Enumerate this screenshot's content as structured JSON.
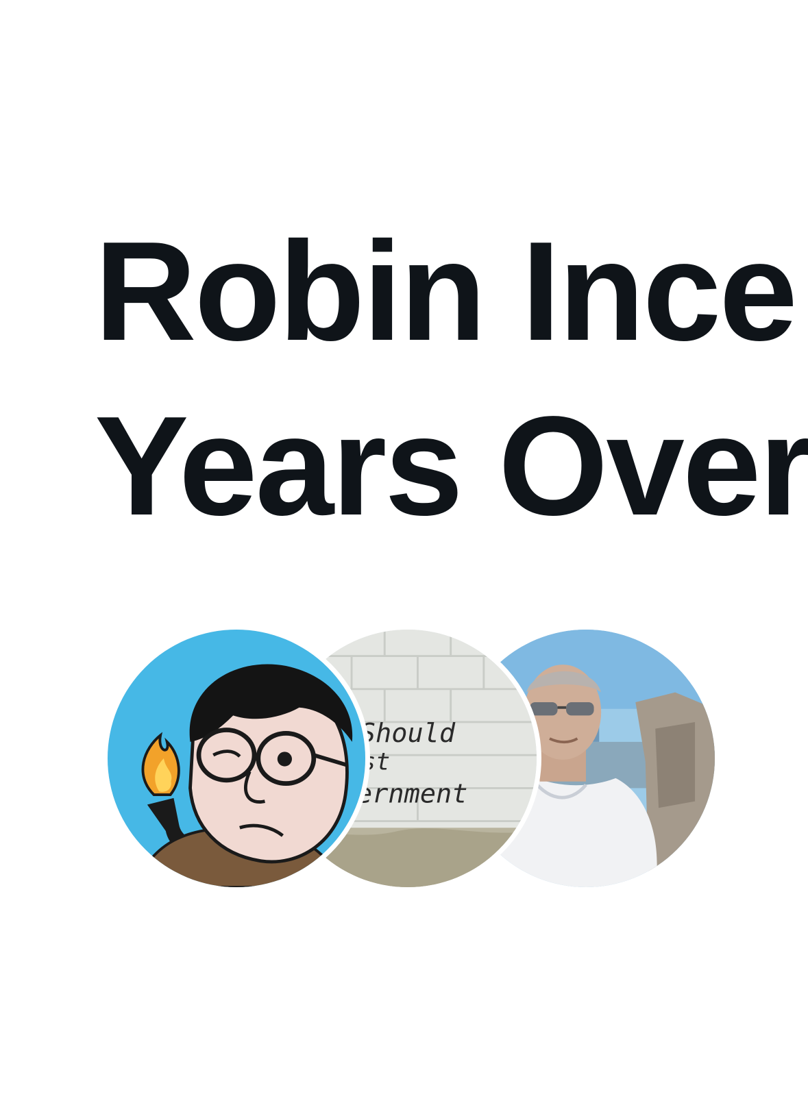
{
  "article": {
    "headline_line1": "Robin Ince",
    "headline_line2": "Years Over"
  },
  "graffiti": {
    "line1": "er Should",
    "line2": "Trust",
    "line3": "Government"
  },
  "colors": {
    "text": "#0f1419",
    "background": "#ffffff",
    "avatar1_sky": "#46b8e6",
    "avatar3_sky": "#9ccbe8"
  },
  "avatars": [
    {
      "icon": "cartoon-man-with-pipe-avatar"
    },
    {
      "icon": "graffiti-wall-avatar"
    },
    {
      "icon": "man-outdoors-photo-avatar"
    }
  ]
}
